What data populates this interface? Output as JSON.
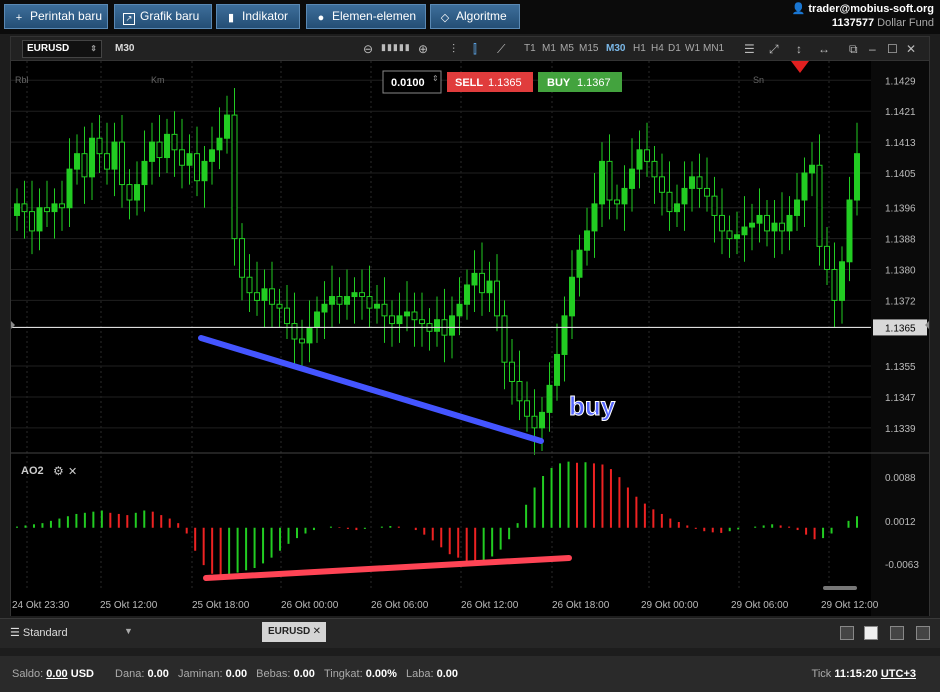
{
  "toolbar": {
    "new_order": "Perintah baru",
    "new_chart": "Grafik baru",
    "indicators": "Indikator",
    "elements": "Elemen-elemen",
    "algorithms": "Algoritme"
  },
  "account": {
    "email": "trader@mobius-soft.org",
    "number": "1137577",
    "fund": "Dollar Fund"
  },
  "chart": {
    "symbol": "EURUSD",
    "timeframe": "M30",
    "timeframes": [
      "T1",
      "M1",
      "M5",
      "M15",
      "M30",
      "H1",
      "H4",
      "D1",
      "W1",
      "MN1"
    ],
    "active_timeframe": "M30",
    "lot": "0.0100",
    "sell_label": "SELL",
    "sell_price": "1.1365",
    "buy_label": "BUY",
    "buy_price": "1.1367",
    "session_labels": [
      "Rbl",
      "Km",
      "Sn"
    ],
    "price_ticks": [
      "1.1429",
      "1.1421",
      "1.1413",
      "1.1405",
      "1.1396",
      "1.1388",
      "1.1380",
      "1.1372",
      "1.1365",
      "1.1355",
      "1.1347",
      "1.1339"
    ],
    "current_price": "1.1365",
    "annotation": "buy",
    "indicator_name": "AO2",
    "indicator_ticks": [
      "0.0088",
      "0.0012",
      "-0.0063"
    ],
    "time_labels": [
      "24 Okt 23:30",
      "25 Okt 12:00",
      "25 Okt 18:00",
      "26 Okt 00:00",
      "26 Okt 06:00",
      "26 Okt 12:00",
      "26 Okt 18:00",
      "29 Okt 00:00",
      "29 Okt 06:00",
      "29 Okt 12:00"
    ],
    "colors": {
      "bull": "#22cc22",
      "bear": "#ee2222",
      "trend_price": "#4455ff",
      "trend_osc": "#ff4455",
      "sell": "#e03c3c",
      "buy": "#43a33e"
    }
  },
  "bottom": {
    "profile": "Standard",
    "tab": "EURUSD"
  },
  "status": {
    "saldo_label": "Saldo:",
    "saldo": "0.00",
    "saldo_cur": "USD",
    "dana_label": "Dana:",
    "dana": "0.00",
    "jaminan_label": "Jaminan:",
    "jaminan": "0.00",
    "bebas_label": "Bebas:",
    "bebas": "0.00",
    "tingkat_label": "Tingkat:",
    "tingkat": "0.00%",
    "laba_label": "Laba:",
    "laba": "0.00",
    "tick_label": "Tick",
    "time": "11:15:20",
    "tz": "UTC+3"
  },
  "chart_data": {
    "type": "candlestick",
    "symbol": "EURUSD",
    "timeframe": "M30",
    "ylim": [
      1.1333,
      1.1434
    ],
    "closes": [
      1.1397,
      1.1395,
      1.139,
      1.1396,
      1.1395,
      1.1397,
      1.1396,
      1.1406,
      1.141,
      1.1404,
      1.1414,
      1.141,
      1.1406,
      1.1413,
      1.1402,
      1.1398,
      1.1402,
      1.1408,
      1.1413,
      1.1409,
      1.1415,
      1.1411,
      1.1407,
      1.141,
      1.1403,
      1.1408,
      1.1411,
      1.1414,
      1.142,
      1.1388,
      1.1378,
      1.1374,
      1.1372,
      1.1375,
      1.1371,
      1.137,
      1.1366,
      1.1362,
      1.1361,
      1.1365,
      1.1369,
      1.1371,
      1.1373,
      1.1371,
      1.1373,
      1.1374,
      1.1373,
      1.137,
      1.1371,
      1.1368,
      1.1366,
      1.1368,
      1.1369,
      1.1367,
      1.1366,
      1.1364,
      1.1367,
      1.1363,
      1.1368,
      1.1371,
      1.1376,
      1.1379,
      1.1374,
      1.1377,
      1.1368,
      1.1356,
      1.1351,
      1.1346,
      1.1342,
      1.1339,
      1.1343,
      1.135,
      1.1358,
      1.1368,
      1.1378,
      1.1385,
      1.139,
      1.1397,
      1.1408,
      1.1398,
      1.1397,
      1.1401,
      1.1406,
      1.1411,
      1.1408,
      1.1404,
      1.14,
      1.1395,
      1.1397,
      1.1401,
      1.1404,
      1.1401,
      1.1399,
      1.1394,
      1.139,
      1.1388,
      1.1389,
      1.1391,
      1.1392,
      1.1394,
      1.139,
      1.1392,
      1.139,
      1.1394,
      1.1398,
      1.1405,
      1.1407,
      1.1386,
      1.138,
      1.1372,
      1.1382,
      1.1398,
      1.141
    ],
    "series": [
      {
        "name": "AO2",
        "values": [
          0.0002,
          0.0004,
          0.0006,
          0.0008,
          0.0012,
          0.0016,
          0.002,
          0.0024,
          0.0026,
          0.0028,
          0.003,
          0.0026,
          0.0024,
          0.0022,
          0.0026,
          0.003,
          0.0028,
          0.0022,
          0.0016,
          0.0008,
          -0.001,
          -0.004,
          -0.0065,
          -0.008,
          -0.0085,
          -0.0082,
          -0.0078,
          -0.0074,
          -0.007,
          -0.0062,
          -0.0052,
          -0.004,
          -0.0028,
          -0.0018,
          -0.001,
          -0.0004,
          0.0,
          0.0002,
          0.0001,
          -0.0002,
          -0.0004,
          -0.0002,
          0.0,
          0.0002,
          0.0003,
          0.0002,
          0.0,
          -0.0004,
          -0.0012,
          -0.0022,
          -0.0034,
          -0.0046,
          -0.0052,
          -0.0058,
          -0.006,
          -0.0057,
          -0.005,
          -0.0038,
          -0.002,
          0.0008,
          0.004,
          0.007,
          0.009,
          0.0104,
          0.0112,
          0.0115,
          0.0113,
          0.0114,
          0.0112,
          0.011,
          0.0102,
          0.0088,
          0.007,
          0.0054,
          0.0042,
          0.0032,
          0.0024,
          0.0016,
          0.001,
          0.0004,
          -0.0002,
          -0.0006,
          -0.0008,
          -0.0009,
          -0.0006,
          -0.0003,
          0.0,
          0.0002,
          0.0004,
          0.0006,
          0.0004,
          0.0002,
          -0.0004,
          -0.0012,
          -0.002,
          -0.0018,
          -0.001,
          0.0,
          0.0012,
          0.002
        ]
      }
    ],
    "osc_ylim": [
      -0.011,
      0.013
    ]
  }
}
